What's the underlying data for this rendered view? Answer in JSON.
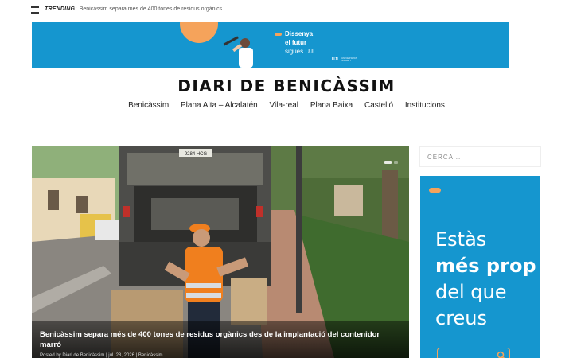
{
  "trending": {
    "label": "TRENDING:",
    "headline": "Benicàssim separa més de 400 tones de residus orgànics ..."
  },
  "top_ad": {
    "line1": "Dissenya",
    "line2": "el futur",
    "line3": "sigues UJI",
    "logo": "UJI",
    "logo_sub": "UNIVERSITAT JAUME I"
  },
  "site": {
    "title": "DIARI DE BENICÀSSIM"
  },
  "nav": [
    "Benicàssim",
    "Plana Alta – Alcalatén",
    "Vila-real",
    "Plana Baixa",
    "Castelló",
    "Institucions"
  ],
  "featured": {
    "title": "Benicàssim separa més de 400 tones de residus orgànics des de la implantació del contenidor marró",
    "meta": "Posted by Diari de Benicàssim | jul. 28, 2026 | Benicàssim",
    "truck_plate": "9284 HCG"
  },
  "sidebar": {
    "search_placeholder": "CERCA ..."
  },
  "side_ad": {
    "line1": "Estàs",
    "line2": "més prop",
    "line3": "del que",
    "line4": "creus"
  },
  "colors": {
    "ad_blue": "#1596cf",
    "ad_orange": "#f5a35b",
    "worker_vest": "#f07f1e"
  },
  "icons": [
    "menu-icon",
    "search-icon"
  ]
}
